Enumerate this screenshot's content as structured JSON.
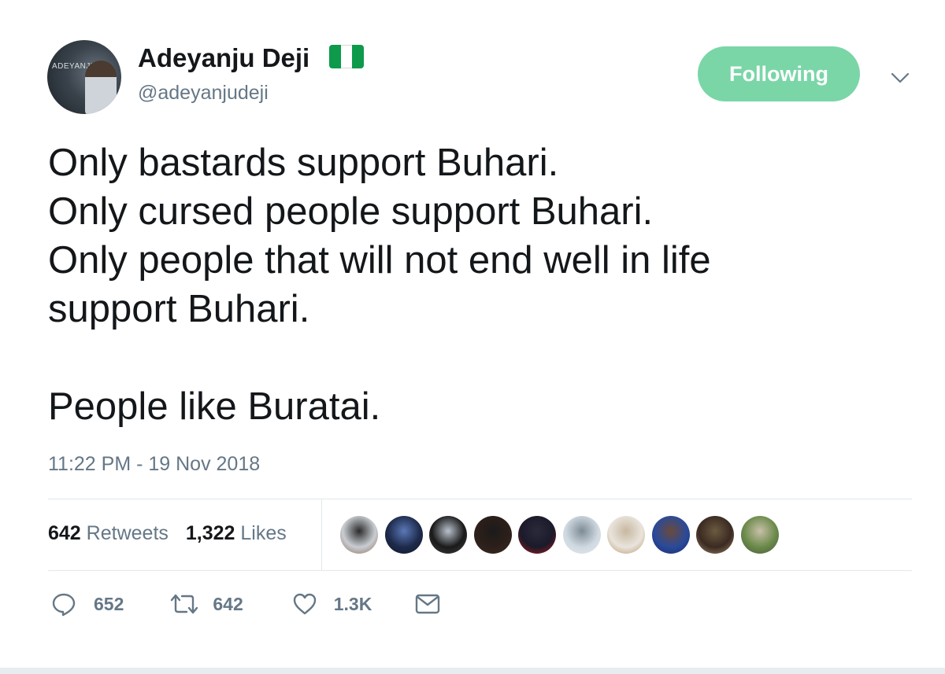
{
  "author": {
    "display_name": "Adeyanju Deji",
    "handle": "@adeyanjudeji",
    "avatar_text": "ADEYANJU",
    "flag_icon": "nigeria-flag-icon"
  },
  "follow_button": {
    "label": "Following",
    "color": "#7ad6a7"
  },
  "tweet": {
    "lines": [
      "Only bastards support Buhari.",
      "Only cursed people support Buhari.",
      "Only people that will not end well in life",
      "support Buhari."
    ],
    "last_line": "People like Buratai.",
    "timestamp": "11:22 PM - 19 Nov 2018"
  },
  "stats": {
    "retweets_count": "642",
    "retweets_label": "Retweets",
    "likes_count": "1,322",
    "likes_label": "Likes"
  },
  "likers": [
    {
      "colors": [
        "#c9cdd2",
        "#2b2b2b",
        "#8a6a55"
      ]
    },
    {
      "colors": [
        "#1d2a4a",
        "#5b78b8",
        "#101828"
      ]
    },
    {
      "colors": [
        "#1a1a1a",
        "#b9c2cc",
        "#444444"
      ]
    },
    {
      "colors": [
        "#2d1f1a",
        "#1b1b1b",
        "#3a2a22"
      ]
    },
    {
      "colors": [
        "#1b1a2a",
        "#2a2a3a",
        "#b31b1b"
      ]
    },
    {
      "colors": [
        "#cfd8e0",
        "#7d8b96",
        "#e6eaee"
      ]
    },
    {
      "colors": [
        "#e9e4dc",
        "#c7b8a0",
        "#b8956a"
      ]
    },
    {
      "colors": [
        "#2a4a9a",
        "#6b4a3a",
        "#1a2a6a"
      ]
    },
    {
      "colors": [
        "#3a2a22",
        "#6b5a40",
        "#a08a6a"
      ]
    },
    {
      "colors": [
        "#6a8a4a",
        "#c9c0a8",
        "#4a5a3a"
      ]
    }
  ],
  "actions": {
    "reply_count": "652",
    "retweet_count": "642",
    "like_count": "1.3K",
    "icons": [
      "reply-icon",
      "retweet-icon",
      "heart-icon",
      "mail-icon"
    ]
  },
  "colors": {
    "text": "#14171a",
    "secondary_text": "#657786",
    "divider": "#e1e8ed"
  }
}
